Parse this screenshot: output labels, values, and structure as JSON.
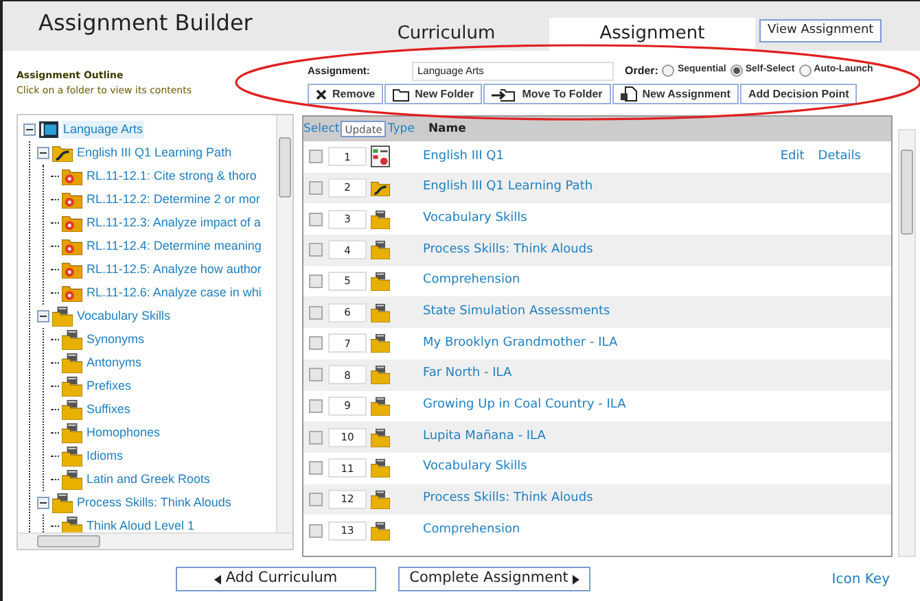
{
  "header": {
    "title": "Assignment Builder",
    "tabs": [
      {
        "label": "Curriculum",
        "selected": false
      },
      {
        "label": "Assignment",
        "selected": true
      }
    ],
    "view_button": "View Assignment"
  },
  "outline": {
    "title": "Assignment Outline",
    "hint": "Click on a folder to view its contents",
    "tree": [
      {
        "label": "Language Arts",
        "kind": "root",
        "selected": true,
        "expanded": true,
        "children": [
          {
            "label": "English III Q1 Learning Path",
            "kind": "path",
            "selected": false,
            "expanded": true,
            "children": [
              {
                "label": "RL.11-12.1: Cite strong & thoro",
                "kind": "standard",
                "selected": false
              },
              {
                "label": "RL.11-12.2: Determine 2 or mor",
                "kind": "standard",
                "selected": false
              },
              {
                "label": "RL.11-12.3: Analyze impact of a",
                "kind": "standard",
                "selected": false
              },
              {
                "label": "RL.11-12.4: Determine meaning",
                "kind": "standard",
                "selected": false
              },
              {
                "label": "RL.11-12.5: Analyze how author",
                "kind": "standard",
                "selected": false
              },
              {
                "label": "RL.11-12.6: Analyze case in whi",
                "kind": "standard",
                "selected": false
              }
            ]
          },
          {
            "label": "Vocabulary Skills",
            "kind": "folder",
            "selected": false,
            "expanded": true,
            "children": [
              {
                "label": "Synonyms",
                "kind": "folder",
                "selected": false
              },
              {
                "label": "Antonyms",
                "kind": "folder",
                "selected": false
              },
              {
                "label": "Prefixes",
                "kind": "folder",
                "selected": false
              },
              {
                "label": "Suffixes",
                "kind": "folder",
                "selected": false
              },
              {
                "label": "Homophones",
                "kind": "folder",
                "selected": false
              },
              {
                "label": "Idioms",
                "kind": "folder",
                "selected": false
              },
              {
                "label": "Latin and Greek Roots",
                "kind": "folder",
                "selected": false
              }
            ]
          },
          {
            "label": "Process Skills: Think Alouds",
            "kind": "folder",
            "selected": false,
            "expanded": true,
            "children": [
              {
                "label": "Think Aloud Level 1",
                "kind": "folder",
                "selected": false
              }
            ]
          }
        ]
      }
    ]
  },
  "toolbar": {
    "assignment_label": "Assignment:",
    "assignment_value": "Language Arts",
    "order_label": "Order:",
    "order_options": [
      {
        "label": "Sequential",
        "selected": false
      },
      {
        "label": "Self-Select",
        "selected": true
      },
      {
        "label": "Auto-Launch",
        "selected": false
      }
    ],
    "buttons": [
      "Remove",
      "New Folder",
      "Move To Folder",
      "New Assignment",
      "Add Decision Point"
    ]
  },
  "table": {
    "select_label": "Select",
    "update_button": "Update",
    "type_label": "Type",
    "name_label": "Name",
    "rows": [
      {
        "checked": false,
        "order": "1",
        "kind": "assessment",
        "name": "English III Q1",
        "actions": [
          "Edit",
          "Details"
        ]
      },
      {
        "checked": false,
        "order": "2",
        "kind": "path",
        "name": "English III Q1 Learning Path"
      },
      {
        "checked": false,
        "order": "3",
        "kind": "folder",
        "name": "Vocabulary Skills"
      },
      {
        "checked": false,
        "order": "4",
        "kind": "folder",
        "name": "Process Skills: Think Alouds"
      },
      {
        "checked": false,
        "order": "5",
        "kind": "folder",
        "name": "Comprehension"
      },
      {
        "checked": false,
        "order": "6",
        "kind": "folder",
        "name": "State Simulation Assessments"
      },
      {
        "checked": false,
        "order": "7",
        "kind": "folder",
        "name": "My Brooklyn Grandmother - ILA"
      },
      {
        "checked": false,
        "order": "8",
        "kind": "folder",
        "name": "Far North - ILA"
      },
      {
        "checked": false,
        "order": "9",
        "kind": "folder",
        "name": "Growing Up in Coal Country - ILA"
      },
      {
        "checked": false,
        "order": "10",
        "kind": "folder",
        "name": "Lupita Mañana - ILA"
      },
      {
        "checked": false,
        "order": "11",
        "kind": "folder",
        "name": "Vocabulary Skills"
      },
      {
        "checked": false,
        "order": "12",
        "kind": "folder",
        "name": "Process Skills: Think Alouds"
      },
      {
        "checked": false,
        "order": "13",
        "kind": "folder",
        "name": "Comprehension"
      }
    ]
  },
  "footer": {
    "buttons": [
      "Add Curriculum",
      "Complete Assignment"
    ],
    "link": "Icon Key"
  }
}
